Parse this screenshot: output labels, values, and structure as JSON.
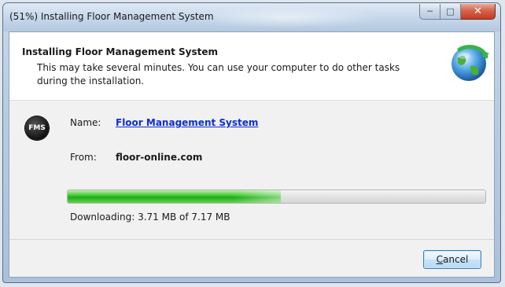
{
  "window": {
    "title": "(51%) Installing Floor Management System",
    "caption_buttons": {
      "minimize_icon": "minimize-icon",
      "maximize_icon": "maximize-icon",
      "close_icon": "close-icon"
    }
  },
  "header": {
    "title": "Installing Floor Management System",
    "description": "This may take several minutes. You can use your computer to do other tasks during the installation.",
    "icon": "globe-install-icon"
  },
  "details": {
    "app_icon_text": "FMS",
    "name_label": "Name:",
    "name_value": "Floor Management System",
    "from_label": "From:",
    "from_value": "floor-online.com"
  },
  "progress": {
    "percent": 51,
    "status": "Downloading: 3.71 MB of 7.17 MB",
    "fill_color": "#37c42a"
  },
  "footer": {
    "cancel_mnemonic": "C",
    "cancel_rest": "ancel"
  }
}
